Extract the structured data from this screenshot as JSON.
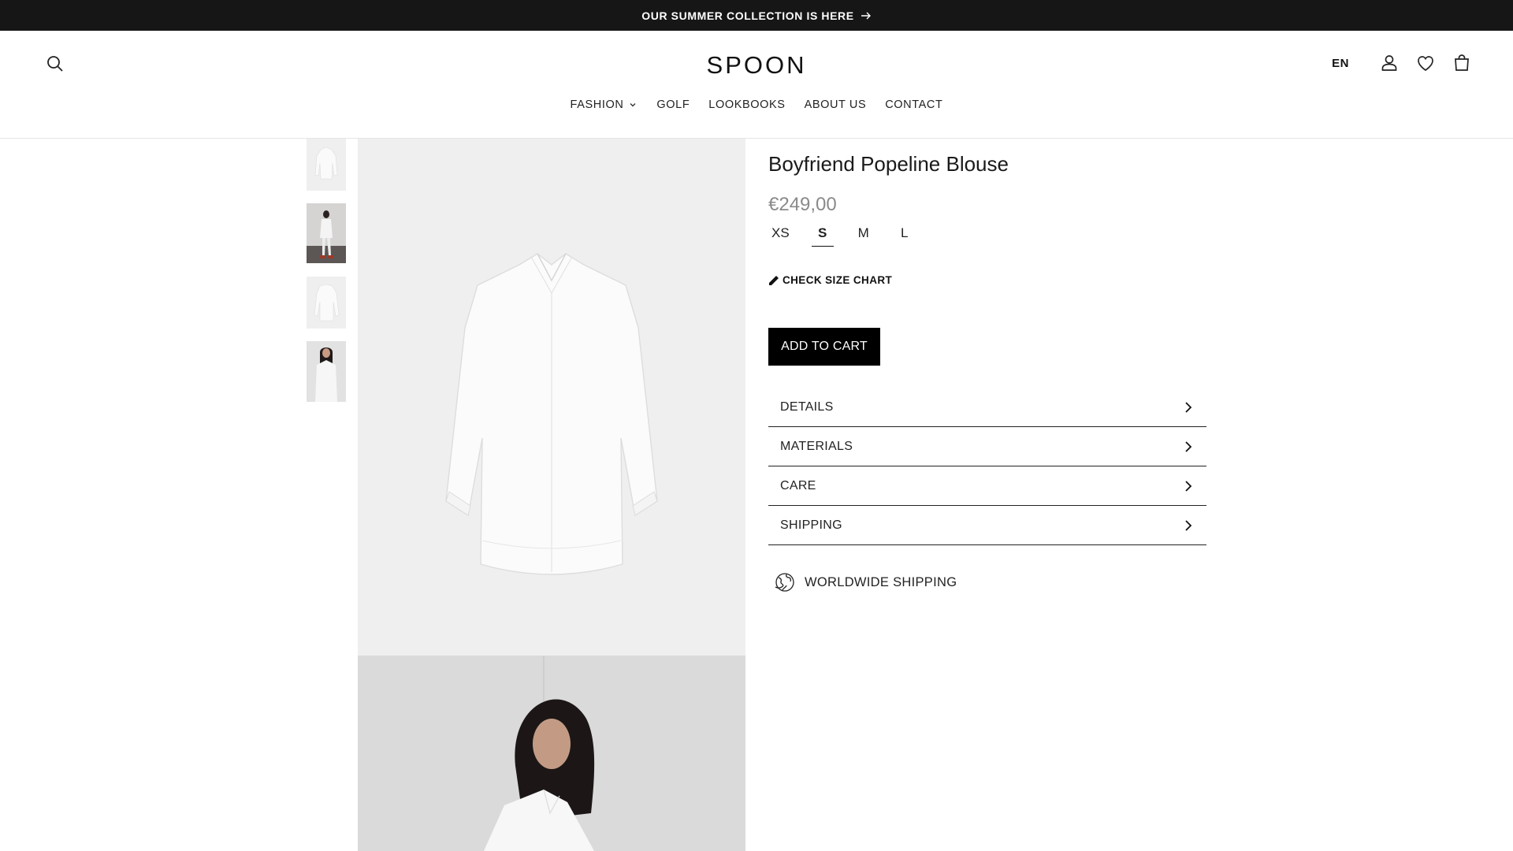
{
  "announcement": {
    "text": "OUR SUMMER COLLECTION IS HERE",
    "arrow_icon": "arrow-right-icon"
  },
  "header": {
    "logo_text": "SPOON",
    "language": "EN",
    "icons": [
      "search-icon",
      "account-icon",
      "heart-icon",
      "cart-icon"
    ],
    "nav": [
      {
        "label": "FASHION",
        "has_dropdown": true
      },
      {
        "label": "GOLF"
      },
      {
        "label": "LOOKBOOKS"
      },
      {
        "label": "ABOUT US"
      },
      {
        "label": "CONTACT"
      }
    ]
  },
  "gallery": {
    "thumbnail_count": 4
  },
  "product": {
    "title": "Boyfriend Popeline Blouse",
    "price": "€249,00",
    "sizes": [
      "XS",
      "S",
      "M",
      "L"
    ],
    "selected_size": "S",
    "size_chart_label": "CHECK SIZE CHART",
    "add_to_cart": "ADD TO CART",
    "accordion": [
      "DETAILS",
      "MATERIALS",
      "CARE",
      "SHIPPING"
    ],
    "shipping_note": "WORLDWIDE SHIPPING"
  },
  "colors": {
    "announcement_bg": "#161616",
    "button_bg": "#000000",
    "price": "#8a8a8a",
    "image_bg": "#efefef"
  }
}
